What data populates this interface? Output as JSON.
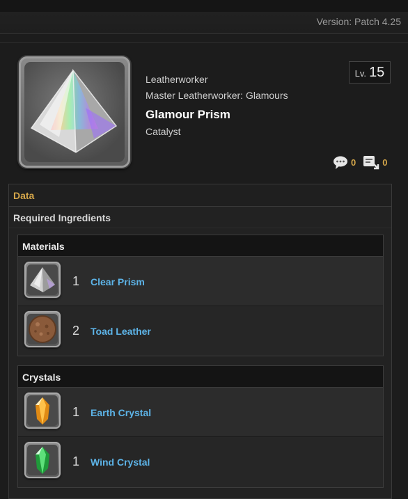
{
  "header": {
    "version": "Version: Patch 4.25"
  },
  "item": {
    "class": "Leatherworker",
    "subcategory": "Master Leatherworker: Glamours",
    "name": "Glamour Prism",
    "category": "Catalyst",
    "level_label": "Lv.",
    "level": "15",
    "icon": "prism-icon"
  },
  "stats": {
    "comments": {
      "icon": "comment-icon",
      "value": "0"
    },
    "clips": {
      "icon": "clip-icon",
      "value": "0"
    }
  },
  "sections": {
    "data_label": "Data",
    "required_label": "Required Ingredients"
  },
  "materials": {
    "title": "Materials",
    "items": [
      {
        "qty": "1",
        "name": "Clear Prism",
        "icon": "clear-prism-icon"
      },
      {
        "qty": "2",
        "name": "Toad Leather",
        "icon": "toad-leather-icon"
      }
    ]
  },
  "crystals": {
    "title": "Crystals",
    "items": [
      {
        "qty": "1",
        "name": "Earth Crystal",
        "icon": "earth-crystal-icon"
      },
      {
        "qty": "1",
        "name": "Wind Crystal",
        "icon": "wind-crystal-icon"
      }
    ]
  },
  "colors": {
    "accent": "#d4a64a",
    "link": "#5db4e8",
    "background": "#1c1c1c"
  }
}
